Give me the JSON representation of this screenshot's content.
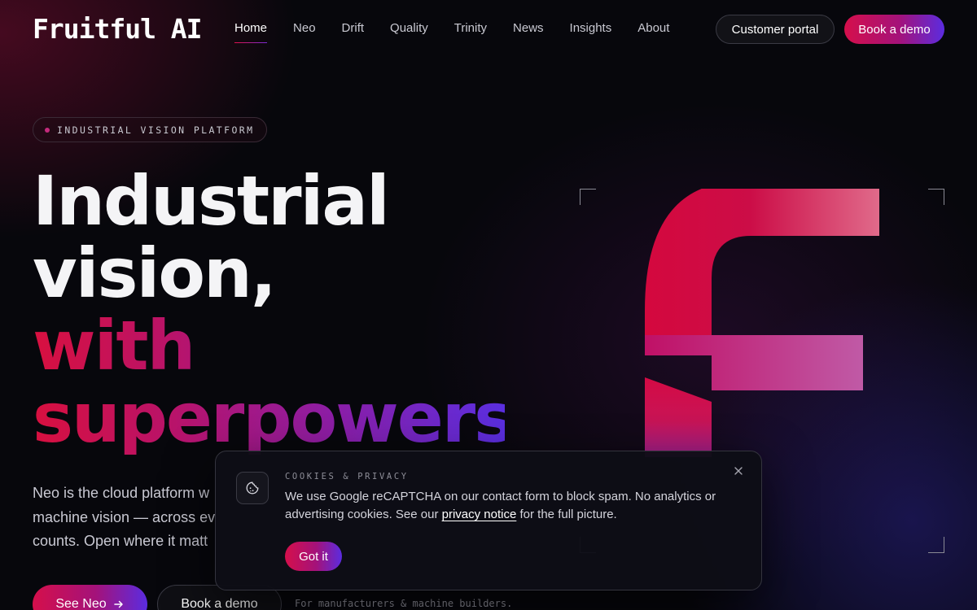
{
  "brand": {
    "logo_text": "Fruitful AI"
  },
  "nav": {
    "links": [
      {
        "label": "Home"
      },
      {
        "label": "Neo"
      },
      {
        "label": "Drift"
      },
      {
        "label": "Quality"
      },
      {
        "label": "Trinity"
      },
      {
        "label": "News"
      },
      {
        "label": "Insights"
      },
      {
        "label": "About"
      }
    ],
    "active": "Home",
    "customer_portal": "Customer portal",
    "book_demo": "Book a demo"
  },
  "hero": {
    "eyebrow": "INDUSTRIAL VISION PLATFORM",
    "headline_line1": "Industrial",
    "headline_line2": "vision,",
    "headline_line3": "with",
    "headline_line4": "superpowers.",
    "subtitle_line1": "Neo is the cloud platform w",
    "subtitle_line2": "machine vision — across ev",
    "subtitle_line3": "counts. Open where it matt",
    "cta_primary": "See Neo",
    "cta_primary_icon": "arrow-right-icon",
    "cta_secondary": "Book a demo",
    "audience_note": "For manufacturers & machine builders."
  },
  "cookie_banner": {
    "title": "COOKIES & PRIVACY",
    "body_before": "We use Google reCAPTCHA on our contact form to block spam. No analytics or advertising cookies. See our ",
    "link_text": "privacy notice",
    "body_after": " for the full picture.",
    "accept": "Got it",
    "icon": "cookie-icon",
    "close_icon": "close-icon"
  },
  "colors": {
    "accent_start": "#d50f4b",
    "accent_mid": "#a4127a",
    "accent_end": "#5b2ce0",
    "background": "#07070c"
  }
}
